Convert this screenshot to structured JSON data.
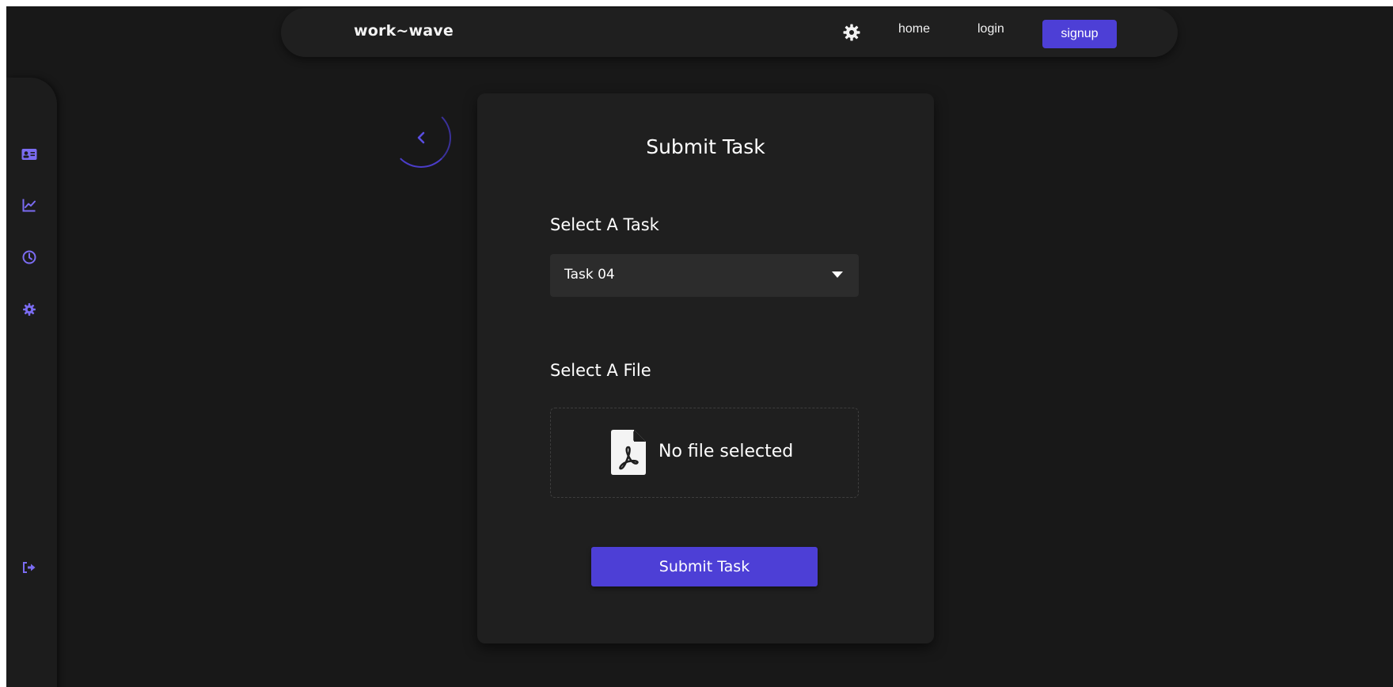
{
  "header": {
    "brand": "work~wave",
    "nav": {
      "home": "home",
      "login": "login",
      "signup": "signup"
    },
    "theme_icon": "gear-icon"
  },
  "sidebar": {
    "items": [
      {
        "icon": "id-card-icon"
      },
      {
        "icon": "chart-line-icon"
      },
      {
        "icon": "clock-icon"
      },
      {
        "icon": "gear-icon"
      }
    ],
    "logout_icon": "logout-icon"
  },
  "form": {
    "title": "Submit Task",
    "task_label": "Select A Task",
    "task_selected": "Task 04",
    "file_label": "Select A File",
    "file_status": "No file selected",
    "file_icon": "pdf-file-icon",
    "submit_label": "Submit Task"
  },
  "colors": {
    "accent": "#4d3fd6",
    "icon_accent": "#7b6cf2",
    "background": "#181818",
    "card": "#1f1f1f"
  }
}
